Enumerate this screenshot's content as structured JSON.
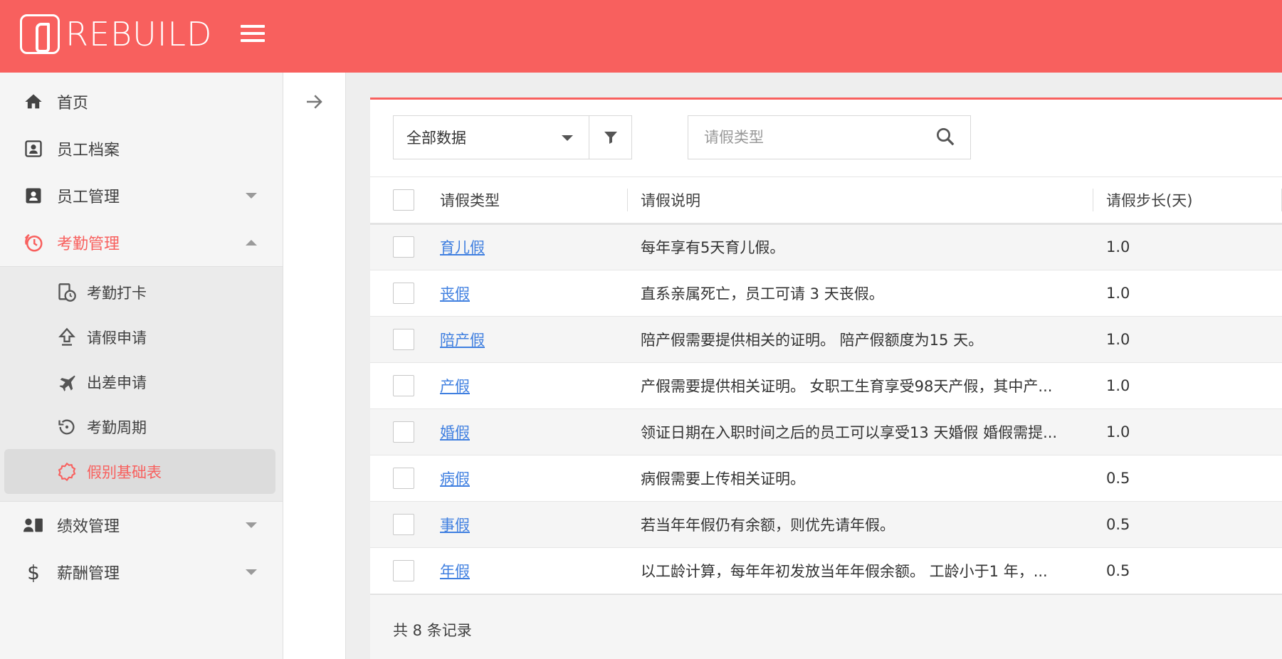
{
  "app": {
    "logo_text": "REBUILD"
  },
  "sidebar": {
    "items": [
      {
        "label": "首页",
        "icon": "home-icon"
      },
      {
        "label": "员工档案",
        "icon": "id-card-icon"
      },
      {
        "label": "员工管理",
        "icon": "contact-card-icon"
      },
      {
        "label": "考勤管理",
        "icon": "alarm-clock-icon"
      }
    ],
    "attendance_sub": [
      {
        "label": "考勤打卡",
        "icon": "clock-in-icon"
      },
      {
        "label": "请假申请",
        "icon": "upload-arrow-icon"
      },
      {
        "label": "出差申请",
        "icon": "airplane-icon"
      },
      {
        "label": "考勤周期",
        "icon": "history-icon"
      },
      {
        "label": "假别基础表",
        "icon": "badge-icon"
      }
    ],
    "bottom_items": [
      {
        "label": "绩效管理",
        "icon": "team-icon"
      },
      {
        "label": "薪酬管理",
        "icon": "dollar-icon"
      }
    ]
  },
  "toolbar": {
    "filter_value": "全部数据",
    "search_placeholder": "请假类型"
  },
  "table": {
    "columns": [
      "请假类型",
      "请假说明",
      "请假步长(天)"
    ],
    "rows": [
      {
        "type": "育儿假",
        "desc": "每年享有5天育儿假。",
        "step": "1.0"
      },
      {
        "type": "丧假",
        "desc": "直系亲属死亡，员工可请 3 天丧假。",
        "step": "1.0"
      },
      {
        "type": "陪产假",
        "desc": "陪产假需要提供相关的证明。 陪产假额度为15 天。",
        "step": "1.0"
      },
      {
        "type": "产假",
        "desc": "产假需要提供相关证明。 女职工生育享受98天产假，其中产...",
        "step": "1.0"
      },
      {
        "type": "婚假",
        "desc": "领证日期在入职时间之后的员工可以享受13 天婚假 婚假需提...",
        "step": "1.0"
      },
      {
        "type": "病假",
        "desc": "病假需要上传相关证明。",
        "step": "0.5"
      },
      {
        "type": "事假",
        "desc": "若当年年假仍有余额，则优先请年假。",
        "step": "0.5"
      },
      {
        "type": "年假",
        "desc": "以工龄计算，每年年初发放当年年假余额。 工龄小于1 年，...",
        "step": "0.5"
      }
    ]
  },
  "footer": {
    "record_count": "共 8 条记录"
  },
  "colors": {
    "accent": "#f8605e",
    "link": "#3f7fe0"
  }
}
